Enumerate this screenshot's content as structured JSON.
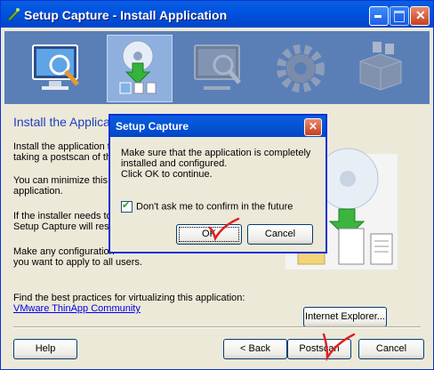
{
  "window": {
    "title": "Setup Capture - Install Application",
    "controls": [
      "minimize-icon",
      "maximize-icon",
      "close-icon"
    ]
  },
  "toolbar": {
    "steps": [
      {
        "icon": "monitor-search-icon",
        "selected": false
      },
      {
        "icon": "cd-install-icon",
        "selected": true
      },
      {
        "icon": "monitor-search-gray-icon",
        "selected": false
      },
      {
        "icon": "gear-icon",
        "selected": false
      },
      {
        "icon": "package-icon",
        "selected": false
      }
    ]
  },
  "main": {
    "heading": "Install the Applica",
    "paragraphs": [
      "Install the application th\ntaking a postscan of th",
      "You can minimize this w\napplication.",
      "If the installer needs to\nSetup Capture will resta",
      "Make any configuration\nyou want to apply to all users."
    ],
    "best_practices": "Find the best practices for virtualizing this application:",
    "community_link": "VMware ThinApp Community",
    "ie_button": "Internet Explorer..."
  },
  "footer": {
    "help": "Help",
    "back": "< Back",
    "postscan": "Postscan",
    "cancel": "Cancel"
  },
  "dialog": {
    "title": "Setup Capture",
    "message": "Make sure that the application is completely installed and configured.\nClick OK to continue.",
    "checkbox_label": "Don't ask me to confirm in the future",
    "checkbox_checked": true,
    "ok": "OK",
    "cancel": "Cancel"
  },
  "colors": {
    "title_blue": "#0053e1",
    "banner": "#5a7fb7",
    "heading": "#1f3fbf",
    "annotation_red": "#e02020"
  }
}
